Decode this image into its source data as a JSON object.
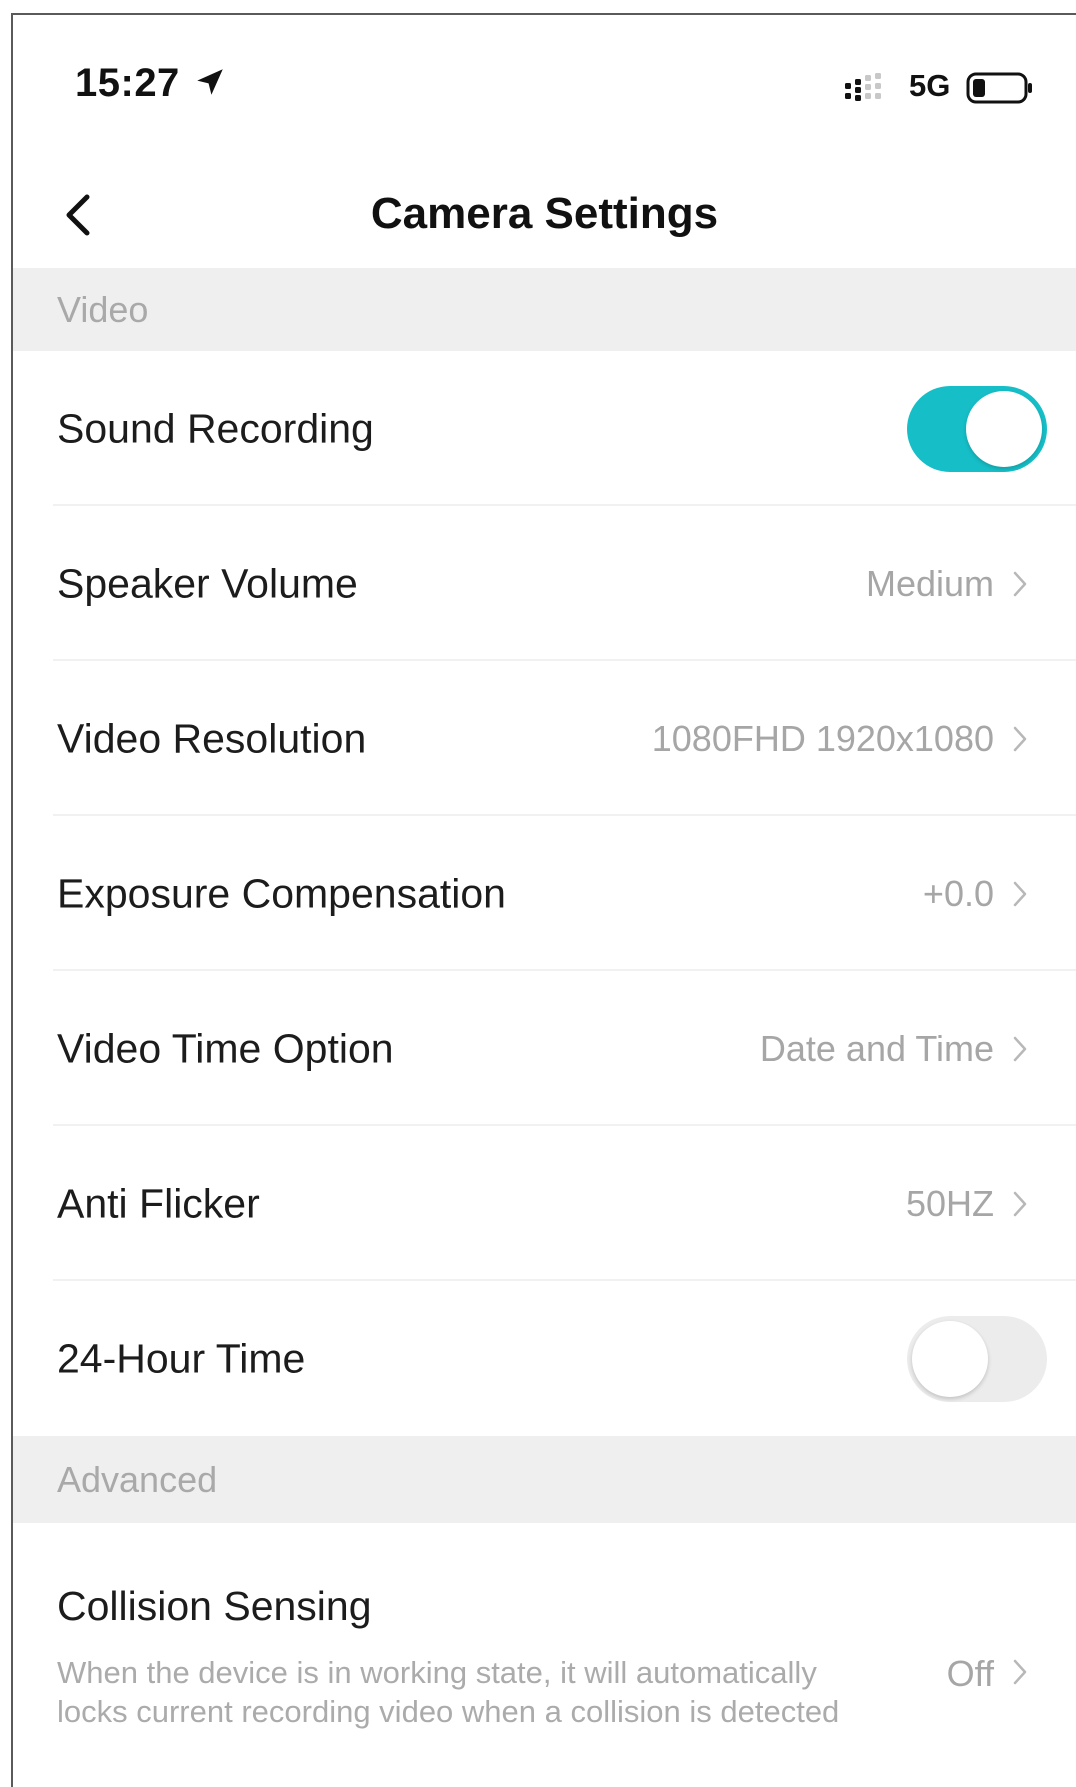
{
  "status_bar": {
    "time": "15:27",
    "network": "5G",
    "icons": [
      "location-arrow-icon",
      "signal-icon",
      "battery-icon"
    ]
  },
  "header": {
    "title": "Camera Settings",
    "back_icon": "chevron-left-icon"
  },
  "sections": {
    "video": {
      "title": "Video",
      "rows": {
        "sound_recording": {
          "label": "Sound Recording",
          "toggle": "on"
        },
        "speaker_volume": {
          "label": "Speaker Volume",
          "value": "Medium"
        },
        "video_resolution": {
          "label": "Video Resolution",
          "value": "1080FHD 1920x1080"
        },
        "exposure_compensation": {
          "label": "Exposure Compensation",
          "value": "+0.0"
        },
        "video_time_option": {
          "label": "Video Time Option",
          "value": "Date and Time"
        },
        "anti_flicker": {
          "label": "Anti Flicker",
          "value": "50HZ"
        },
        "hour_24_time": {
          "label": "24-Hour Time",
          "toggle": "off"
        }
      }
    },
    "advanced": {
      "title": "Advanced",
      "rows": {
        "collision_sensing": {
          "label": "Collision Sensing",
          "description": "When the device is in working state, it will automatically locks current recording video when a collision is detected",
          "value": "Off"
        }
      }
    }
  },
  "colors": {
    "accent": "#16bfc8",
    "section_bg": "#efefef",
    "muted_text": "#a6a6a6",
    "primary_text": "#1c1c1c"
  }
}
